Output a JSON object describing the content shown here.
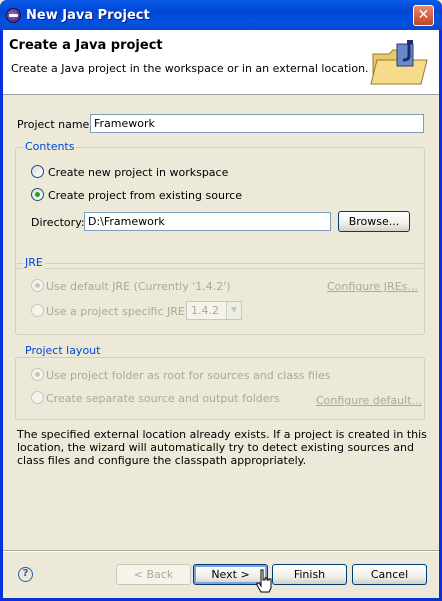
{
  "window": {
    "title": "New Java Project"
  },
  "header": {
    "title": "Create a Java project",
    "description": "Create a Java project in the workspace or in an external location.",
    "banner_icon": "java-project-folder-icon"
  },
  "project_name": {
    "label": "Project name:",
    "value": "Framework"
  },
  "contents": {
    "title": "Contents",
    "option_new": "Create new project in workspace",
    "option_existing": "Create project from existing source",
    "directory_label": "Directory:",
    "directory_value": "D:\\Framework",
    "browse_label": "Browse..."
  },
  "jre": {
    "title": "JRE",
    "option_default": "Use default JRE (Currently '1.4.2')",
    "option_specific": "Use a project specific JRE:",
    "selected_version": "1.4.2",
    "configure_link": "Configure JREs..."
  },
  "layout": {
    "title": "Project layout",
    "option_root": "Use project folder as root for sources and class files",
    "option_separate": "Create separate source and output folders",
    "configure_link": "Configure default..."
  },
  "message": "The specified external location already exists. If a project is created in this location, the wizard will automatically try to detect existing sources and class files and configure the classpath appropriately.",
  "buttons": {
    "back": "< Back",
    "next": "Next >",
    "finish": "Finish",
    "cancel": "Cancel"
  },
  "colors": {
    "titlebar": "#0054e3",
    "group_title": "#0046d5",
    "disabled_text": "#aca899"
  }
}
